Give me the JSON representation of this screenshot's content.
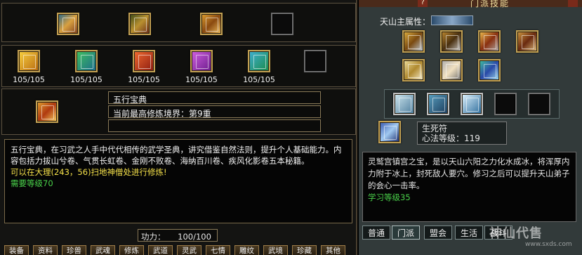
{
  "left": {
    "top_row_items": [
      {
        "name": "book-icon-1",
        "color": "#4a8a9a"
      },
      {
        "name": "scroll-icon-2",
        "color": "#6a7a2a"
      },
      {
        "name": "chest-icon-3",
        "color": "#b87a22"
      }
    ],
    "scroll_items": [
      {
        "name": "yellow-scroll-icon",
        "color": "#d8a018",
        "count": "105/105"
      },
      {
        "name": "green-scroll-icon",
        "color": "#2a9a4a",
        "count": "105/105"
      },
      {
        "name": "red-scroll-icon",
        "color": "#c83a1a",
        "count": "105/105"
      },
      {
        "name": "purple-scroll-icon",
        "color": "#a83ab8",
        "count": "105/105"
      },
      {
        "name": "teal-scroll-icon",
        "color": "#2a8aa8",
        "count": "105/105"
      }
    ],
    "selected_item": {
      "name": "五行宝典",
      "realm": "当前最高修炼境界：第9重",
      "extra": ""
    },
    "description": {
      "body": "五行宝典，在习武之人手中代代相传的武学圣典，讲究借鉴自然法则，提升个人基础能力。内容包括力拔山兮卷、气贯长虹卷、金刚不败卷、海纳百川卷、疾风化影卷五本秘籍。",
      "location": "可以在大理(243，56)扫地神僧处进行修炼!",
      "requirement": "需要等级70"
    },
    "power": {
      "label": "功力：",
      "value": "100/100"
    },
    "tabs": [
      "装备",
      "资料",
      "珍兽",
      "武魂",
      "修炼",
      "武道",
      "灵武",
      "七情",
      "雕纹",
      "武境",
      "珍藏",
      "其他"
    ]
  },
  "right": {
    "title": "门派技能",
    "attr_label": "天山主属性：",
    "skill_rows": [
      [
        "skill-icon",
        "skill-icon",
        "skill-icon",
        "skill-icon"
      ],
      [
        "skill-icon",
        "skill-icon",
        "skill-icon"
      ]
    ],
    "passive_count": 3,
    "selected_skill": {
      "name": "生死符",
      "level": "心法等级：119"
    },
    "description": {
      "body": "灵鹫宫镇宫之宝，是以天山六阳之力化水成冰，将浑厚内力附于冰上，封死敌人要穴。修习之后可以提升天山弟子的会心一击率。",
      "requirement": "学习等级35"
    },
    "tabs": [
      "普通",
      "门派",
      "盟会",
      "生活",
      "战斗"
    ],
    "active_tab": 1,
    "watermark": "神仙代售",
    "watermark_sub": "www.sxds.com"
  },
  "colors": {
    "frame_gold": "#c2a052",
    "text_green": "#4ad24a",
    "text_yellow": "#f4e04a"
  }
}
